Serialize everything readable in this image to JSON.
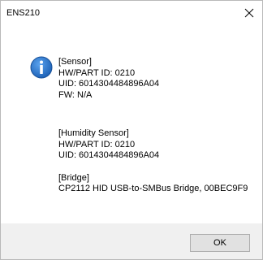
{
  "window": {
    "title": "ENS210",
    "close_icon": "close-icon"
  },
  "dialog": {
    "icon": "info-icon",
    "icon_color": "#1a6fc9",
    "sensor": {
      "heading": "[Sensor]",
      "hw_part_id": "HW/PART ID: 0210",
      "uid": "UID: 6014304484896A04",
      "fw": "FW: N/A"
    },
    "humidity_sensor": {
      "heading": "[Humidity Sensor]",
      "hw_part_id": "HW/PART ID: 0210",
      "uid": "UID: 6014304484896A04"
    },
    "bridge": {
      "heading": "[Bridge]",
      "description": "CP2112 HID USB-to-SMBus Bridge, 00BEC9F9"
    }
  },
  "footer": {
    "ok_label": "OK"
  }
}
